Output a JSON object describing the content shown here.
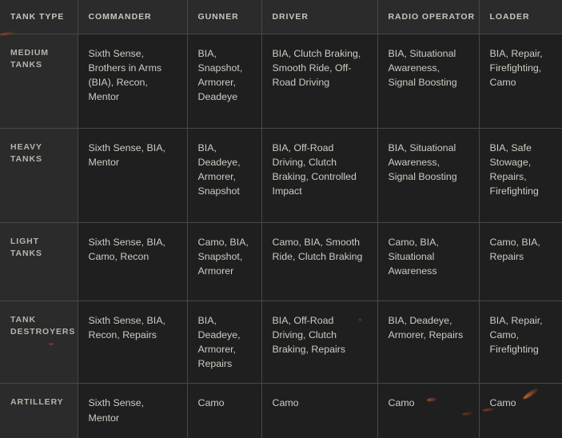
{
  "table": {
    "columns": [
      {
        "key": "tank_type",
        "label": "TANK TYPE"
      },
      {
        "key": "commander",
        "label": "COMMANDER"
      },
      {
        "key": "gunner",
        "label": "GUNNER"
      },
      {
        "key": "driver",
        "label": "DRIVER"
      },
      {
        "key": "radio_operator",
        "label": "RADIO OPERATOR"
      },
      {
        "key": "loader",
        "label": "LOADER"
      }
    ],
    "rows": [
      {
        "tank_type": "MEDIUM TANKS",
        "commander": "Sixth Sense, Brothers in Arms (BIA), Recon, Mentor",
        "gunner": "BIA, Snapshot, Armorer, Deadeye",
        "driver": "BIA, Clutch Braking, Smooth Ride, Off-Road Driving",
        "radio_operator": "BIA, Situational Awareness, Signal Boosting",
        "loader": "BIA, Repair, Firefighting, Camo"
      },
      {
        "tank_type": "HEAVY TANKS",
        "commander": "Sixth Sense, BIA, Mentor",
        "gunner": "BIA, Deadeye, Armorer, Snapshot",
        "driver": "BIA, Off-Road Driving, Clutch Braking, Controlled Impact",
        "radio_operator": "BIA, Situational Awareness, Signal Boosting",
        "loader": "BIA, Safe Stowage, Repairs, Firefighting"
      },
      {
        "tank_type": "LIGHT TANKS",
        "commander": "Sixth Sense, BIA, Camo, Recon",
        "gunner": "Camo, BIA, Snapshot, Armorer",
        "driver": "Camo, BIA, Smooth Ride, Clutch Braking",
        "radio_operator": "Camo, BIA, Situational Awareness",
        "loader": "Camo, BIA, Repairs"
      },
      {
        "tank_type": "TANK DESTROYERS",
        "commander": "Sixth Sense, BIA, Recon, Repairs",
        "gunner": "BIA, Deadeye, Armorer, Repairs",
        "driver": "BIA, Off-Road Driving, Clutch Braking, Repairs",
        "radio_operator": "BIA, Deadeye, Armorer, Repairs",
        "loader": "BIA, Repair, Camo, Firefighting"
      },
      {
        "tank_type": "ARTILLERY",
        "commander": "Sixth Sense, Mentor",
        "gunner": "Camo",
        "driver": "Camo",
        "radio_operator": "Camo",
        "loader": "Camo"
      }
    ]
  },
  "colors": {
    "page_background": "#1f1f1f",
    "header_background": "#2b2b2b",
    "row_header_background": "#2b2b2b",
    "cell_background": "#1f1f1f",
    "border": "#4a4844",
    "header_text": "#c9c5bd",
    "cell_text": "#cfcbc3",
    "spark_accent": "#c4531e"
  }
}
